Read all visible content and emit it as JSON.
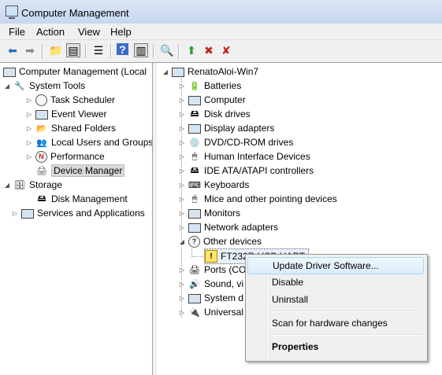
{
  "window": {
    "title": "Computer Management"
  },
  "menu": [
    "File",
    "Action",
    "View",
    "Help"
  ],
  "toolbar": {
    "icons": [
      "back-arrow-icon",
      "forward-arrow-icon",
      "up-folder-icon",
      "show-hide-tree-icon",
      "properties-icon",
      "help-icon",
      "show-hide-action-pane-icon",
      "scan-hardware-icon",
      "update-driver-icon",
      "disable-device-icon",
      "uninstall-device-icon"
    ]
  },
  "left_tree": {
    "root": "Computer Management (Local",
    "system_tools": "System Tools",
    "task_scheduler": "Task Scheduler",
    "event_viewer": "Event Viewer",
    "shared_folders": "Shared Folders",
    "local_users": "Local Users and Groups",
    "performance": "Performance",
    "device_manager": "Device Manager",
    "storage": "Storage",
    "disk_management": "Disk Management",
    "services": "Services and Applications"
  },
  "right_tree": {
    "computer": "RenatoAloi-Win7",
    "categories": [
      "Batteries",
      "Computer",
      "Disk drives",
      "Display adapters",
      "DVD/CD-ROM drives",
      "Human Interface Devices",
      "IDE ATA/ATAPI controllers",
      "Keyboards",
      "Mice and other pointing devices",
      "Monitors",
      "Network adapters",
      "Other devices"
    ],
    "unknown_device": "FT232R USB UART",
    "partial_items": [
      "Ports (CO",
      "Sound, vi",
      "System d",
      "Universal"
    ]
  },
  "context_menu": {
    "update": "Update Driver Software...",
    "disable": "Disable",
    "uninstall": "Uninstall",
    "scan": "Scan for hardware changes",
    "properties": "Properties"
  }
}
